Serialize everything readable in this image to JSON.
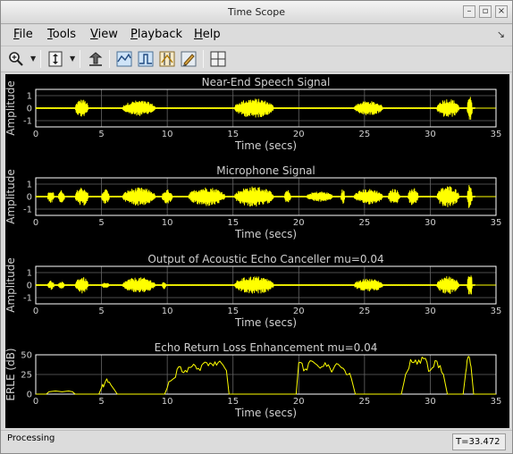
{
  "window": {
    "title": "Time Scope"
  },
  "menubar": {
    "items": [
      {
        "label": "File",
        "key": "F",
        "rest": "ile"
      },
      {
        "label": "Tools",
        "key": "T",
        "rest": "ools"
      },
      {
        "label": "View",
        "key": "V",
        "rest": "iew"
      },
      {
        "label": "Playback",
        "key": "P",
        "rest": "layback"
      },
      {
        "label": "Help",
        "key": "H",
        "rest": "elp"
      }
    ]
  },
  "toolbar": {
    "icons": [
      "zoom-icon",
      "dropdown-arrow-icon",
      "scale-axes-icon",
      "dropdown-arrow-icon",
      "restore-view-icon",
      "signal-pan-icon",
      "triggers-icon",
      "cursor-measurements-icon",
      "peak-finder-icon",
      "layout-icon"
    ]
  },
  "status": {
    "text": "Processing",
    "time": "T=33.472"
  },
  "colors": {
    "background": "#000000",
    "axes": "#ffffff",
    "signal": "#ffff00",
    "grid": "#666666",
    "label": "#d0d0d0"
  },
  "chart_data": [
    {
      "type": "line",
      "title": "Near-End Speech Signal",
      "xlabel": "Time (secs)",
      "ylabel": "Amplitude",
      "xlim": [
        0,
        35
      ],
      "ylim": [
        -1.5,
        1.5
      ],
      "xticks": [
        0,
        5,
        10,
        15,
        20,
        25,
        30,
        35
      ],
      "yticks": [
        1,
        0,
        -1
      ],
      "bursts": [
        [
          3.0,
          4.0,
          0.7
        ],
        [
          6.6,
          9.1,
          0.6
        ],
        [
          15.1,
          18.1,
          0.75
        ],
        [
          24.2,
          26.4,
          0.55
        ],
        [
          30.5,
          32.2,
          0.75
        ],
        [
          32.8,
          33.2,
          1.0
        ]
      ],
      "grid": true
    },
    {
      "type": "line",
      "title": "Microphone Signal",
      "xlabel": "Time (secs)",
      "ylabel": "Amplitude",
      "xlim": [
        0,
        35
      ],
      "ylim": [
        -1.5,
        1.5
      ],
      "xticks": [
        0,
        5,
        10,
        15,
        20,
        25,
        30,
        35
      ],
      "yticks": [
        1,
        0,
        -1
      ],
      "bursts": [
        [
          0.9,
          1.4,
          0.5
        ],
        [
          1.7,
          2.2,
          0.5
        ],
        [
          3.0,
          4.0,
          0.75
        ],
        [
          5.0,
          5.6,
          0.6
        ],
        [
          6.6,
          9.1,
          0.7
        ],
        [
          9.6,
          10.4,
          0.55
        ],
        [
          11.6,
          14.4,
          0.75
        ],
        [
          15.1,
          18.1,
          0.8
        ],
        [
          18.9,
          19.4,
          0.5
        ],
        [
          20.6,
          22.6,
          0.4
        ],
        [
          23.2,
          23.5,
          0.6
        ],
        [
          24.2,
          26.4,
          0.6
        ],
        [
          26.8,
          27.7,
          0.6
        ],
        [
          28.3,
          29.1,
          0.7
        ],
        [
          30.5,
          32.2,
          0.85
        ],
        [
          32.8,
          33.2,
          1.0
        ]
      ],
      "grid": true
    },
    {
      "type": "line",
      "title": "Output of Acoustic Echo Canceller mu=0.04",
      "xlabel": "Time (secs)",
      "ylabel": "Amplitude",
      "xlim": [
        0,
        35
      ],
      "ylim": [
        -1.5,
        1.5
      ],
      "xticks": [
        0,
        5,
        10,
        15,
        20,
        25,
        30,
        35
      ],
      "yticks": [
        1,
        0,
        -1
      ],
      "bursts": [
        [
          0.9,
          1.4,
          0.35
        ],
        [
          1.7,
          2.2,
          0.25
        ],
        [
          3.0,
          4.0,
          0.65
        ],
        [
          5.0,
          5.6,
          0.2
        ],
        [
          6.6,
          9.1,
          0.6
        ],
        [
          9.6,
          9.9,
          0.3
        ],
        [
          15.1,
          18.1,
          0.7
        ],
        [
          24.2,
          26.4,
          0.5
        ],
        [
          30.5,
          32.2,
          0.7
        ],
        [
          32.8,
          33.2,
          1.0
        ]
      ],
      "grid": true
    },
    {
      "type": "line",
      "title": "Echo Return Loss Enhancement mu=0.04",
      "xlabel": "Time (secs)",
      "ylabel": "ERLE (dB)",
      "xlim": [
        0,
        35
      ],
      "ylim": [
        0,
        50
      ],
      "xticks": [
        0,
        5,
        10,
        15,
        20,
        25,
        30,
        35
      ],
      "yticks": [
        50,
        25,
        0
      ],
      "x": [
        0,
        0.8,
        1.0,
        1.5,
        2.0,
        2.5,
        2.8,
        3.0,
        4.8,
        5.0,
        5.3,
        5.7,
        6.0,
        6.2,
        9.8,
        10.0,
        10.5,
        11.0,
        11.5,
        12.0,
        12.5,
        13.0,
        13.5,
        14.0,
        14.5,
        14.7,
        19.8,
        20.0,
        20.5,
        21.0,
        21.5,
        22.0,
        22.5,
        23.0,
        23.5,
        24.0,
        24.3,
        27.8,
        28.0,
        28.5,
        29.0,
        29.5,
        30.0,
        30.5,
        31.0,
        31.3,
        32.5,
        32.7,
        32.9,
        33.1,
        33.3,
        35
      ],
      "y": [
        0,
        0,
        3,
        4,
        3,
        4,
        3,
        0,
        0,
        8,
        16,
        12,
        5,
        0,
        0,
        8,
        20,
        35,
        28,
        38,
        30,
        40,
        36,
        42,
        30,
        0,
        0,
        40,
        32,
        42,
        35,
        40,
        28,
        38,
        30,
        20,
        0,
        0,
        15,
        44,
        38,
        45,
        30,
        42,
        25,
        0,
        0,
        28,
        48,
        35,
        0,
        0
      ],
      "grid": true
    }
  ]
}
